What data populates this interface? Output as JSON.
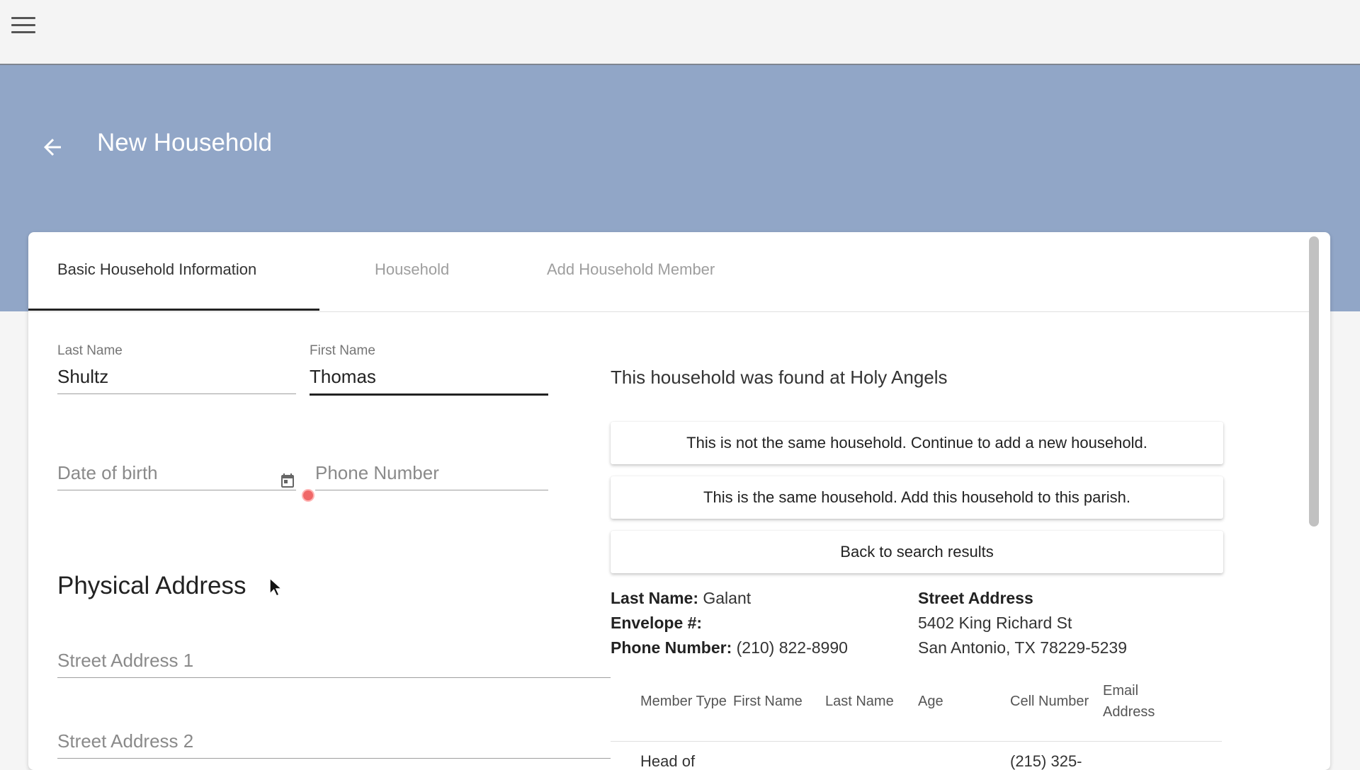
{
  "header": {
    "menu_icon": "menu-icon"
  },
  "page": {
    "title": "New Household",
    "back_icon": "arrow-left-icon"
  },
  "tabs": [
    {
      "label": "Basic Household Information",
      "active": true
    },
    {
      "label": "Household",
      "active": false
    },
    {
      "label": "Add Household Member",
      "active": false
    }
  ],
  "form": {
    "last_name": {
      "label": "Last Name",
      "value": "Shultz"
    },
    "first_name": {
      "label": "First Name",
      "value": "Thomas"
    },
    "dob": {
      "placeholder": "Date of birth",
      "icon": "calendar-icon"
    },
    "phone": {
      "placeholder": "Phone Number"
    },
    "physical_address": {
      "title": "Physical Address",
      "street1_placeholder": "Street Address 1",
      "street2_placeholder": "Street Address 2"
    }
  },
  "match": {
    "message": "This household was found at Holy Angels",
    "buttons": {
      "not_same": "This is not the same household. Continue to add a new household.",
      "same": "This is the same household. Add this household to this parish.",
      "back": "Back to search results"
    },
    "details": {
      "last_name_label": "Last Name:",
      "last_name": "Galant",
      "envelope_label": "Envelope #:",
      "envelope": "",
      "phone_label": "Phone Number:",
      "phone": "(210) 822-8990",
      "street_label": "Street Address",
      "street_line1": "5402 King Richard St",
      "street_line2": "San Antonio, TX 78229-5239"
    },
    "table": {
      "headers": [
        "Member Type",
        "First Name",
        "Last Name",
        "Age",
        "Cell Number",
        "Email",
        "Address"
      ],
      "rows": [
        [
          "Head of",
          "",
          "",
          "",
          "(215) 325-",
          ""
        ]
      ]
    }
  },
  "colors": {
    "hero": "#91a6c7",
    "topbar": "#f4f4f4",
    "card": "#ffffff",
    "indicator": "#f06868"
  }
}
